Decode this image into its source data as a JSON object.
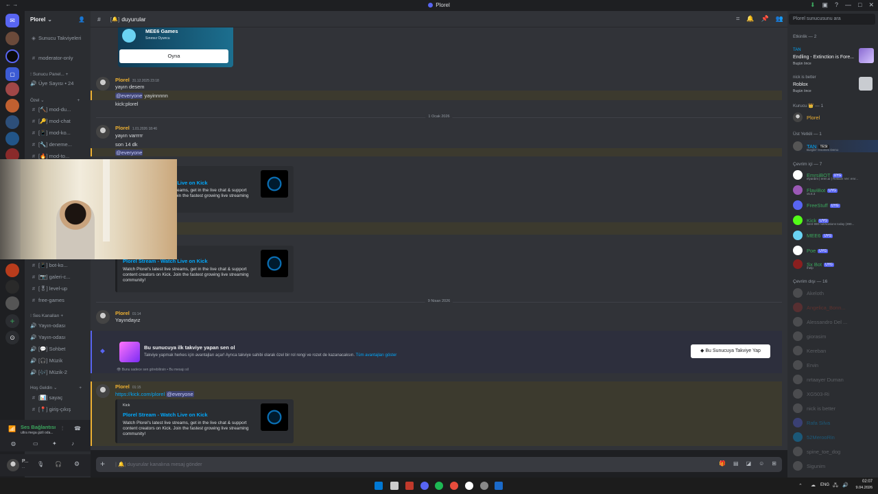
{
  "window": {
    "title": "Plorel"
  },
  "server": {
    "name": "Plorel"
  },
  "channel": {
    "name": "duyurular",
    "emoji": "🔔"
  },
  "sidebar": {
    "top_items": [
      {
        "label": "Sunucu Takviyeleri",
        "icon": "boost-icon"
      },
      {
        "label": "moderator-only",
        "icon": "hash-icon"
      }
    ],
    "categories": {
      "sunucu": "Sunucu Panel...",
      "ozel": "Özel",
      "ses": "Ses Kanalları",
      "hos": "Hoş Geldin"
    },
    "uye_sayisi": "Üye Sayısı • 24",
    "private_channels": [
      {
        "label": "mod-du...",
        "badge": "[🔨]"
      },
      {
        "label": "mod-chat",
        "badge": "[🔑]"
      },
      {
        "label": "mod-ko...",
        "badge": "[📱]"
      },
      {
        "label": "deneme...",
        "badge": "[🔧]"
      },
      {
        "label": "mod-to...",
        "badge": "[🔥]"
      }
    ],
    "more_channels": [
      {
        "label": "bot-ko...",
        "badge": "[📱]"
      },
      {
        "label": "galeri-c...",
        "badge": "[📷]"
      },
      {
        "label": "level-up",
        "badge": "[🎖]"
      },
      {
        "label": "free-games",
        "badge": ""
      }
    ],
    "voice_channels": [
      {
        "label": "Yayın-odası",
        "badge": ""
      },
      {
        "label": "Yayın-odası",
        "badge": ""
      },
      {
        "label": "Sohbet",
        "badge": "[💬]"
      },
      {
        "label": "Müzik",
        "badge": "[🎧]"
      },
      {
        "label": "Müzik-2",
        "badge": "[🎶]"
      }
    ],
    "welcome_channels": [
      {
        "label": "sayaç",
        "badge": "[📊]"
      },
      {
        "label": "giriş-çıkış",
        "badge": "[📍]"
      }
    ]
  },
  "voice_panel": {
    "status": "Ses Bağlantısı",
    "detail": "ultra mega gizli oda..."
  },
  "user_panel": {
    "name": "P...",
    "status": "..."
  },
  "messages": [
    {
      "type": "embed_top",
      "title": "MEE6 Games",
      "sub": "Sınırsız Oyuncu",
      "button": "Oyna"
    },
    {
      "author": "Plorel",
      "time": "31.12.2025 23:18",
      "lines": [
        "yayın desem"
      ],
      "mention_line": {
        "mention": "@everyone",
        "text": " yayinnnnn"
      },
      "after_lines": [
        "kick:plorel"
      ]
    },
    {
      "divider": "1 Ocak 2026"
    },
    {
      "author": "Plorel",
      "time": "1.01.2026 18:46",
      "lines": [
        "yayın varrrrr",
        "son 14 dk"
      ],
      "mention_line": {
        "mention": "@everyone",
        "text": ""
      }
    },
    {
      "type": "embed",
      "provider": "Kick",
      "title": "Plorel Stream - Watch Live on Kick",
      "desc": "Watch Plorel's latest live streams, get in the live chat & support content creators on Kick. Join the fastest growing live streaming community!"
    },
    {
      "type": "embed",
      "provider": "Kick",
      "title": "Plorel Stream - Watch Live on Kick",
      "desc": "Watch Plorel's latest live streams, get in the live chat & support content creators on Kick. Join the fastest growing live streaming community!"
    },
    {
      "divider": "9 Nisan 2026"
    },
    {
      "author": "Plorel",
      "time": "01:14",
      "lines": [
        "Yayındayız"
      ]
    },
    {
      "type": "boost",
      "title": "Bu sunucuya ilk takviye yapan sen ol",
      "desc": "Takviye yapmak herkes için avantajları açar! Ayrıca takviye sahibi olarak özel bir rol rengi ve rozet de kazanacaksın.",
      "link": "Tüm avantajları göster",
      "button": "Bu Sunucuya Takviye Yap",
      "note": "Bunu sadece sen görebilirsin • Bu mesajı sil"
    },
    {
      "author": "Plorel",
      "time": "01:15",
      "link": "https://kick.com/plorel",
      "mention": "@everyone",
      "embed": {
        "provider": "Kick",
        "title": "Plorel Stream - Watch Live on Kick",
        "desc": "Watch Plorel's latest live streams, get in the live chat & support content creators on Kick. Join the fastest growing live streaming community!"
      }
    }
  ],
  "composer": {
    "placeholder": "duyurular kanalına mesaj gönder"
  },
  "search": {
    "placeholder": "Plorel sunucusunu ara"
  },
  "members": {
    "activity_header": "Etkinlik — 2",
    "activities": [
      {
        "user": "TAN",
        "game": "Endling - Extinction is Fore...",
        "when": "Bugün önce"
      },
      {
        "user": "nick is better",
        "game": "Roblox",
        "when": "Bugün önce"
      }
    ],
    "founder_header": "Kurucu 👑 — 1",
    "founder": "Plorel",
    "admin_header": "Üst Yetkili — 1",
    "admin": {
      "name": "TAN",
      "badge": "TESt",
      "sub": "Burglin' Gnomes Demo"
    },
    "online_header": "Çevrim içi — 7",
    "online": [
      {
        "name": "EmrsiBOT",
        "badge": "UYG",
        "sub": "elyardim | eren.ai | Reklam Ver: emr...",
        "color": "#3ba55d"
      },
      {
        "name": "FlaviBot",
        "badge": "UYG",
        "sub": "v5.6.3",
        "color": "#3ba55d"
      },
      {
        "name": "FreeStuff",
        "badge": "UYG",
        "sub": "",
        "color": "#3ba55d"
      },
      {
        "name": "Kick",
        "badge": "UYG",
        "sub": "Sent 990 notifications today (390...",
        "color": "#3ba55d"
      },
      {
        "name": "MEE6",
        "badge": "UYG",
        "sub": "",
        "color": "#3ba55d"
      },
      {
        "name": "Poe",
        "badge": "UYG",
        "sub": "",
        "color": "#3ba55d"
      },
      {
        "name": "Sx Bot",
        "badge": "UYG",
        "sub": "/help",
        "color": "#3ba55d"
      }
    ],
    "offline_header": "Çevrim dışı — 16",
    "offline": [
      "Akeloth",
      "Angelica_Bonn...",
      "Alessandro Del ...",
      "giorasim",
      "Kereban",
      "Ervin",
      "nrtaayer Duman",
      "XG503-Ri",
      "nick is better",
      "Rafa Silva",
      "52MerooRin",
      "spine_toe_dog",
      "Sigunim"
    ]
  },
  "taskbar": {
    "lang": "ENG",
    "time": "02:07",
    "date": "9.04.2026"
  }
}
